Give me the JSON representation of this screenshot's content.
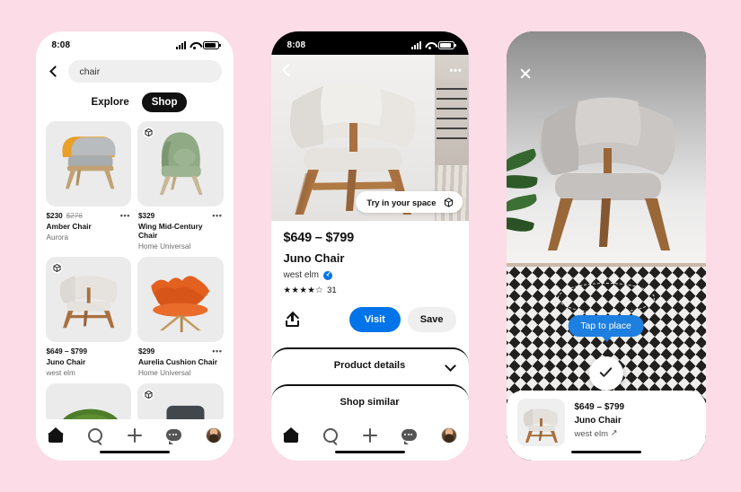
{
  "background_color": "#fcdce6",
  "accent_blue": "#0074e8",
  "phone1": {
    "status": {
      "time": "8:08",
      "signal_icon": "cellular-bars-icon",
      "wifi_icon": "wifi-icon",
      "battery_icon": "battery-icon"
    },
    "back_icon": "back-chevron-icon",
    "search": {
      "value": "chair",
      "placeholder": "Search"
    },
    "tabs": [
      {
        "label": "Explore",
        "active": false
      },
      {
        "label": "Shop",
        "active": true
      }
    ],
    "products": [
      {
        "price": "$230",
        "price_old": "$276",
        "name": "Amber Chair",
        "brand": "Aurora",
        "ar": false,
        "overflow": "•••"
      },
      {
        "price": "$329",
        "price_old": "",
        "name": "Wing Mid-Century Chair",
        "brand": "Home Universal",
        "ar": true,
        "overflow": "•••"
      },
      {
        "price": "$649 – $799",
        "price_old": "",
        "name": "Juno Chair",
        "brand": "west elm",
        "ar": true,
        "overflow": ""
      },
      {
        "price": "$299",
        "price_old": "",
        "name": "Aurelia Cushion Chair",
        "brand": "Home Universal",
        "ar": false,
        "overflow": "•••"
      }
    ],
    "nav": [
      {
        "icon": "home-icon",
        "label": "Home"
      },
      {
        "icon": "search-icon",
        "label": "Search"
      },
      {
        "icon": "plus-icon",
        "label": "Create"
      },
      {
        "icon": "chat-icon",
        "label": "Inbox"
      },
      {
        "icon": "avatar-icon",
        "label": "Profile"
      }
    ]
  },
  "phone2": {
    "status": {
      "time": "8:08",
      "signal_icon": "cellular-bars-icon",
      "wifi_icon": "wifi-icon",
      "battery_icon": "battery-icon"
    },
    "back_icon": "back-chevron-icon",
    "overflow": "•••",
    "try_in_space": {
      "label": "Try in your space",
      "icon": "ar-cube-icon"
    },
    "product": {
      "price": "$649 – $799",
      "name": "Juno Chair",
      "brand": "west elm",
      "verified_icon": "verified-badge-icon",
      "stars": "★★★★☆",
      "rating_count": "31"
    },
    "actions": {
      "share_icon": "share-icon",
      "visit_label": "Visit",
      "save_label": "Save"
    },
    "sheets": [
      {
        "label": "Product details",
        "chevron": "chevron-down-icon"
      },
      {
        "label": "Shop similar",
        "chevron": ""
      }
    ],
    "nav": [
      {
        "icon": "home-icon",
        "label": "Home"
      },
      {
        "icon": "search-icon",
        "label": "Search"
      },
      {
        "icon": "plus-icon",
        "label": "Create"
      },
      {
        "icon": "chat-icon",
        "label": "Inbox"
      },
      {
        "icon": "avatar-icon",
        "label": "Profile"
      }
    ]
  },
  "phone3": {
    "close_icon": "close-icon",
    "tap_to_place": "Tap to place",
    "confirm_icon": "check-icon",
    "placement_ring": "placement-ellipse",
    "card": {
      "price": "$649 – $799",
      "name": "Juno Chair",
      "brand": "west elm",
      "external_link_icon": "↗"
    }
  }
}
